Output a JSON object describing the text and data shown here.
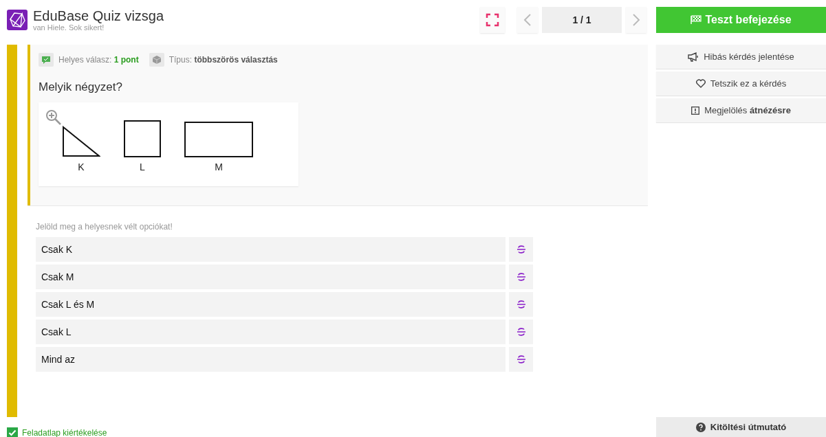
{
  "header": {
    "title": "EduBase Quiz vizsga",
    "subtitle": "van Hiele. Sok sikert!",
    "page_indicator": "1 / 1",
    "finish_button": "Teszt befejezése"
  },
  "question": {
    "score_label": "Helyes válasz:",
    "score_value": "1 pont",
    "type_label": "Típus:",
    "type_value": "többszörös választás",
    "text": "Melyik négyzet?",
    "figure_labels": [
      "K",
      "L",
      "M"
    ]
  },
  "instruction": "Jelöld meg a helyesnek vélt opciókat!",
  "options": [
    {
      "label": "Csak K"
    },
    {
      "label": "Csak M"
    },
    {
      "label": "Csak L és M"
    },
    {
      "label": "Csak L"
    },
    {
      "label": "Mind az"
    }
  ],
  "side_buttons": [
    {
      "kind": "report",
      "label": "Hibás kérdés jelentése"
    },
    {
      "kind": "like",
      "label": "Tetszik ez a kérdés"
    },
    {
      "kind": "flag",
      "label": "Megjelölés **átnézésre**"
    }
  ],
  "evaluation": {
    "label": "Feladatlap kiértékelése",
    "checked": true
  },
  "help_button": "Kitöltési útmutató"
}
